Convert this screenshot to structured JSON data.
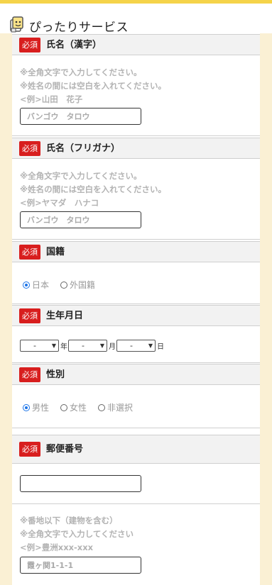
{
  "header": {
    "logo_text": "ぴったりサービス",
    "logo_icon": "mascot-icon"
  },
  "badge_label": "必須",
  "sections": {
    "name_kanji": {
      "title": "氏名（漢字）",
      "notes": [
        "※全角文字で入力してください。",
        "※姓名の間には空白を入れてください。",
        "<例>山田　花子"
      ],
      "placeholder": "バンゴウ　タロウ"
    },
    "name_kana": {
      "title": "氏名（フリガナ）",
      "notes": [
        "※全角文字で入力してください。",
        "※姓名の間には空白を入れてください。",
        "<例>ヤマダ　ハナコ"
      ],
      "placeholder": "バンゴウ　タロウ"
    },
    "nationality": {
      "title": "国籍",
      "options": [
        "日本",
        "外国籍"
      ],
      "selected": "日本"
    },
    "birthdate": {
      "title": "生年月日",
      "year_value": "-",
      "month_value": "-",
      "day_value": "-",
      "year_unit": "年",
      "month_unit": "月",
      "day_unit": "日"
    },
    "gender": {
      "title": "性別",
      "options": [
        "男性",
        "女性",
        "非選択"
      ],
      "selected": "男性"
    },
    "postal": {
      "title": "郵便番号",
      "value": ""
    },
    "address": {
      "notes": [
        "※番地以下（建物を含む）",
        "※全角文字で入力してください",
        "<例>豊洲xxx-xxx"
      ],
      "placeholder": "霞ヶ関1-1-1"
    }
  }
}
